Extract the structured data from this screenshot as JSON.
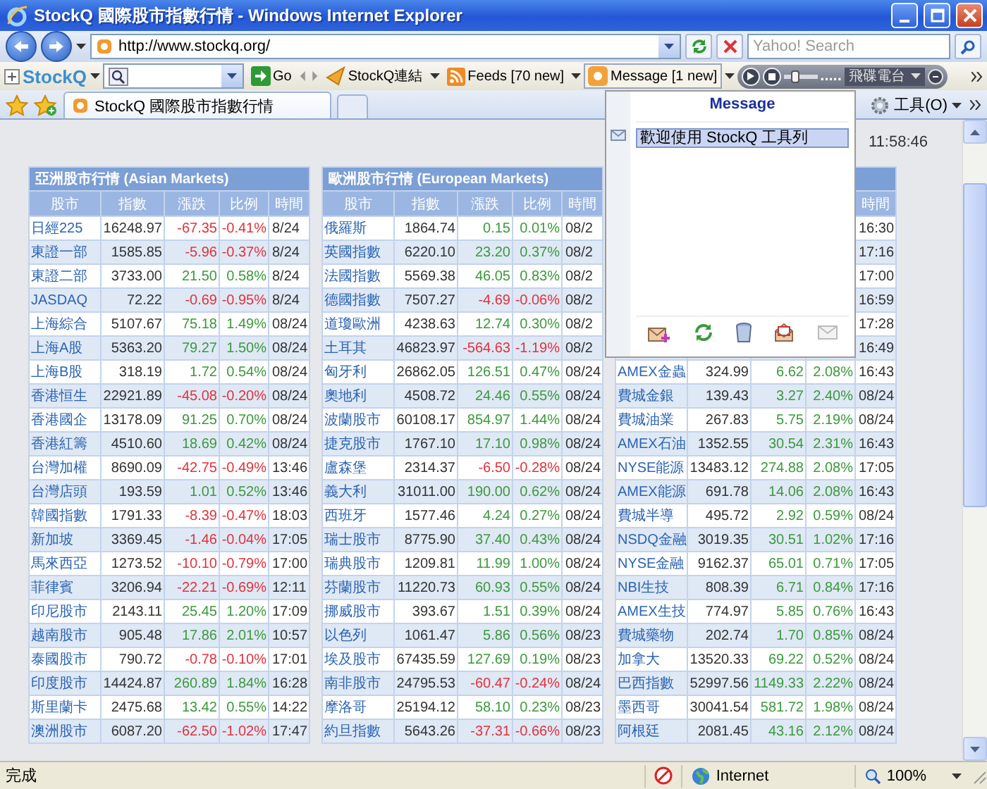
{
  "window": {
    "title": "StockQ 國際股市指數行情 - Windows Internet Explorer"
  },
  "address_bar": {
    "url": "http://www.stockq.org/",
    "search_placeholder": "Yahoo! Search"
  },
  "toolbar": {
    "logo": "StockQ",
    "go": "Go",
    "links": "StockQ連結",
    "feeds": "Feeds [70 new]",
    "message": "Message [1 new]",
    "volume": {
      "level": 0.35
    },
    "player_dots": ".....",
    "station": "飛碟電台"
  },
  "tabs": [
    {
      "label": "StockQ 國際股市指數行情",
      "selected": true
    }
  ],
  "tools_menu": "工具(O)",
  "message_popup": {
    "title": "Message",
    "items": [
      {
        "text": "歡迎使用 StockQ 工具列",
        "selected": true
      }
    ]
  },
  "page": {
    "update_time": "11:58:46",
    "tables": [
      {
        "title": "亞洲股市行情 (Asian Markets)",
        "columns": [
          "股市",
          "指數",
          "漲跌",
          "比例",
          "時間"
        ],
        "rows": [
          {
            "name": "日經225",
            "index": "16248.97",
            "change": "-67.35",
            "pct": "-0.41%",
            "time": "8/24",
            "down": true
          },
          {
            "name": "東證一部",
            "index": "1585.85",
            "change": "-5.96",
            "pct": "-0.37%",
            "time": "8/24",
            "down": true
          },
          {
            "name": "東證二部",
            "index": "3733.00",
            "change": "21.50",
            "pct": "0.58%",
            "time": "8/24",
            "down": false
          },
          {
            "name": "JASDAQ",
            "index": "72.22",
            "change": "-0.69",
            "pct": "-0.95%",
            "time": "8/24",
            "down": true
          },
          {
            "name": "上海綜合",
            "index": "5107.67",
            "change": "75.18",
            "pct": "1.49%",
            "time": "08/24",
            "down": false
          },
          {
            "name": "上海A股",
            "index": "5363.20",
            "change": "79.27",
            "pct": "1.50%",
            "time": "08/24",
            "down": false
          },
          {
            "name": "上海B股",
            "index": "318.19",
            "change": "1.72",
            "pct": "0.54%",
            "time": "08/24",
            "down": false
          },
          {
            "name": "香港恒生",
            "index": "22921.89",
            "change": "-45.08",
            "pct": "-0.20%",
            "time": "08/24",
            "down": true
          },
          {
            "name": "香港國企",
            "index": "13178.09",
            "change": "91.25",
            "pct": "0.70%",
            "time": "08/24",
            "down": false
          },
          {
            "name": "香港紅籌",
            "index": "4510.60",
            "change": "18.69",
            "pct": "0.42%",
            "time": "08/24",
            "down": false
          },
          {
            "name": "台灣加權",
            "index": "8690.09",
            "change": "-42.75",
            "pct": "-0.49%",
            "time": "13:46",
            "down": true
          },
          {
            "name": "台灣店頭",
            "index": "193.59",
            "change": "1.01",
            "pct": "0.52%",
            "time": "13:46",
            "down": false
          },
          {
            "name": "韓國指數",
            "index": "1791.33",
            "change": "-8.39",
            "pct": "-0.47%",
            "time": "18:03",
            "down": true
          },
          {
            "name": "新加坡",
            "index": "3369.45",
            "change": "-1.46",
            "pct": "-0.04%",
            "time": "17:05",
            "down": true
          },
          {
            "name": "馬來西亞",
            "index": "1273.52",
            "change": "-10.10",
            "pct": "-0.79%",
            "time": "17:00",
            "down": true
          },
          {
            "name": "菲律賓",
            "index": "3206.94",
            "change": "-22.21",
            "pct": "-0.69%",
            "time": "12:11",
            "down": true
          },
          {
            "name": "印尼股市",
            "index": "2143.11",
            "change": "25.45",
            "pct": "1.20%",
            "time": "17:09",
            "down": false
          },
          {
            "name": "越南股市",
            "index": "905.48",
            "change": "17.86",
            "pct": "2.01%",
            "time": "10:57",
            "down": false
          },
          {
            "name": "泰國股市",
            "index": "790.72",
            "change": "-0.78",
            "pct": "-0.10%",
            "time": "17:01",
            "down": true
          },
          {
            "name": "印度股市",
            "index": "14424.87",
            "change": "260.89",
            "pct": "1.84%",
            "time": "16:28",
            "down": false
          },
          {
            "name": "斯里蘭卡",
            "index": "2475.68",
            "change": "13.42",
            "pct": "0.55%",
            "time": "14:22",
            "down": false
          },
          {
            "name": "澳洲股市",
            "index": "6087.20",
            "change": "-62.50",
            "pct": "-1.02%",
            "time": "17:47",
            "down": true
          }
        ]
      },
      {
        "title": "歐洲股市行情 (European Markets)",
        "columns": [
          "股市",
          "指數",
          "漲跌",
          "比例",
          "時間"
        ],
        "rows": [
          {
            "name": "俄羅斯",
            "index": "1864.74",
            "change": "0.15",
            "pct": "0.01%",
            "time": "08/2",
            "down": false
          },
          {
            "name": "英國指數",
            "index": "6220.10",
            "change": "23.20",
            "pct": "0.37%",
            "time": "08/2",
            "down": false
          },
          {
            "name": "法國指數",
            "index": "5569.38",
            "change": "46.05",
            "pct": "0.83%",
            "time": "08/2",
            "down": false
          },
          {
            "name": "德國指數",
            "index": "7507.27",
            "change": "-4.69",
            "pct": "-0.06%",
            "time": "08/2",
            "down": true
          },
          {
            "name": "道瓊歐洲",
            "index": "4238.63",
            "change": "12.74",
            "pct": "0.30%",
            "time": "08/2",
            "down": false
          },
          {
            "name": "土耳其",
            "index": "46823.97",
            "change": "-564.63",
            "pct": "-1.19%",
            "time": "08/2",
            "down": true
          },
          {
            "name": "匈牙利",
            "index": "26862.05",
            "change": "126.51",
            "pct": "0.47%",
            "time": "08/24",
            "down": false
          },
          {
            "name": "奧地利",
            "index": "4508.72",
            "change": "24.46",
            "pct": "0.55%",
            "time": "08/24",
            "down": false
          },
          {
            "name": "波蘭股市",
            "index": "60108.17",
            "change": "854.97",
            "pct": "1.44%",
            "time": "08/24",
            "down": false
          },
          {
            "name": "捷克股市",
            "index": "1767.10",
            "change": "17.10",
            "pct": "0.98%",
            "time": "08/24",
            "down": false
          },
          {
            "name": "盧森堡",
            "index": "2314.37",
            "change": "-6.50",
            "pct": "-0.28%",
            "time": "08/24",
            "down": true
          },
          {
            "name": "義大利",
            "index": "31011.00",
            "change": "190.00",
            "pct": "0.62%",
            "time": "08/24",
            "down": false
          },
          {
            "name": "西班牙",
            "index": "1577.46",
            "change": "4.24",
            "pct": "0.27%",
            "time": "08/24",
            "down": false
          },
          {
            "name": "瑞士股市",
            "index": "8775.90",
            "change": "37.40",
            "pct": "0.43%",
            "time": "08/24",
            "down": false
          },
          {
            "name": "瑞典股市",
            "index": "1209.81",
            "change": "11.99",
            "pct": "1.00%",
            "time": "08/24",
            "down": false
          },
          {
            "name": "芬蘭股市",
            "index": "11220.73",
            "change": "60.93",
            "pct": "0.55%",
            "time": "08/24",
            "down": false
          },
          {
            "name": "挪威股市",
            "index": "393.67",
            "change": "1.51",
            "pct": "0.39%",
            "time": "08/24",
            "down": false
          },
          {
            "name": "以色列",
            "index": "1061.47",
            "change": "5.86",
            "pct": "0.56%",
            "time": "08/23",
            "down": false
          },
          {
            "name": "埃及股市",
            "index": "67435.59",
            "change": "127.69",
            "pct": "0.19%",
            "time": "08/23",
            "down": false
          },
          {
            "name": "南非股市",
            "index": "24795.53",
            "change": "-60.47",
            "pct": "-0.24%",
            "time": "08/24",
            "down": true
          },
          {
            "name": "摩洛哥",
            "index": "25194.12",
            "change": "58.10",
            "pct": "0.23%",
            "time": "08/23",
            "down": false
          },
          {
            "name": "約旦指數",
            "index": "5643.26",
            "change": "-37.31",
            "pct": "-0.66%",
            "time": "08/23",
            "down": true
          }
        ]
      },
      {
        "columns": [
          "時間"
        ],
        "rows": [
          {
            "time": "16:30"
          },
          {
            "time": "17:16"
          },
          {
            "time": "17:00"
          },
          {
            "time": "16:59"
          },
          {
            "time": "17:28"
          },
          {
            "time": "16:49"
          },
          {
            "name": "AMEX金蟲",
            "index": "324.99",
            "change": "6.62",
            "pct": "2.08%",
            "time": "16:43",
            "down": false
          },
          {
            "name": "費城金銀",
            "index": "139.43",
            "change": "3.27",
            "pct": "2.40%",
            "time": "08/24",
            "down": false
          },
          {
            "name": "費城油業",
            "index": "267.83",
            "change": "5.75",
            "pct": "2.19%",
            "time": "08/24",
            "down": false
          },
          {
            "name": "AMEX石油",
            "index": "1352.55",
            "change": "30.54",
            "pct": "2.31%",
            "time": "16:43",
            "down": false
          },
          {
            "name": "NYSE能源",
            "index": "13483.12",
            "change": "274.88",
            "pct": "2.08%",
            "time": "17:05",
            "down": false
          },
          {
            "name": "AMEX能源",
            "index": "691.78",
            "change": "14.06",
            "pct": "2.08%",
            "time": "16:43",
            "down": false
          },
          {
            "name": "費城半導",
            "index": "495.72",
            "change": "2.92",
            "pct": "0.59%",
            "time": "08/24",
            "down": false
          },
          {
            "name": "NSDQ金融",
            "index": "3019.35",
            "change": "30.51",
            "pct": "1.02%",
            "time": "17:16",
            "down": false
          },
          {
            "name": "NYSE金融",
            "index": "9162.37",
            "change": "65.01",
            "pct": "0.71%",
            "time": "17:05",
            "down": false
          },
          {
            "name": "NBI生技",
            "index": "808.39",
            "change": "6.71",
            "pct": "0.84%",
            "time": "17:16",
            "down": false
          },
          {
            "name": "AMEX生技",
            "index": "774.97",
            "change": "5.85",
            "pct": "0.76%",
            "time": "16:43",
            "down": false
          },
          {
            "name": "費城藥物",
            "index": "202.74",
            "change": "1.70",
            "pct": "0.85%",
            "time": "08/24",
            "down": false
          },
          {
            "name": "加拿大",
            "index": "13520.33",
            "change": "69.22",
            "pct": "0.52%",
            "time": "08/24",
            "down": false
          },
          {
            "name": "巴西指數",
            "index": "52997.56",
            "change": "1149.33",
            "pct": "2.22%",
            "time": "08/24",
            "down": false
          },
          {
            "name": "墨西哥",
            "index": "30041.54",
            "change": "581.72",
            "pct": "1.98%",
            "time": "08/24",
            "down": false
          },
          {
            "name": "阿根廷",
            "index": "2081.45",
            "change": "43.16",
            "pct": "2.12%",
            "time": "08/24",
            "down": false
          }
        ]
      }
    ]
  },
  "status_bar": {
    "status": "完成",
    "zone": "Internet",
    "zoom": "100%"
  }
}
